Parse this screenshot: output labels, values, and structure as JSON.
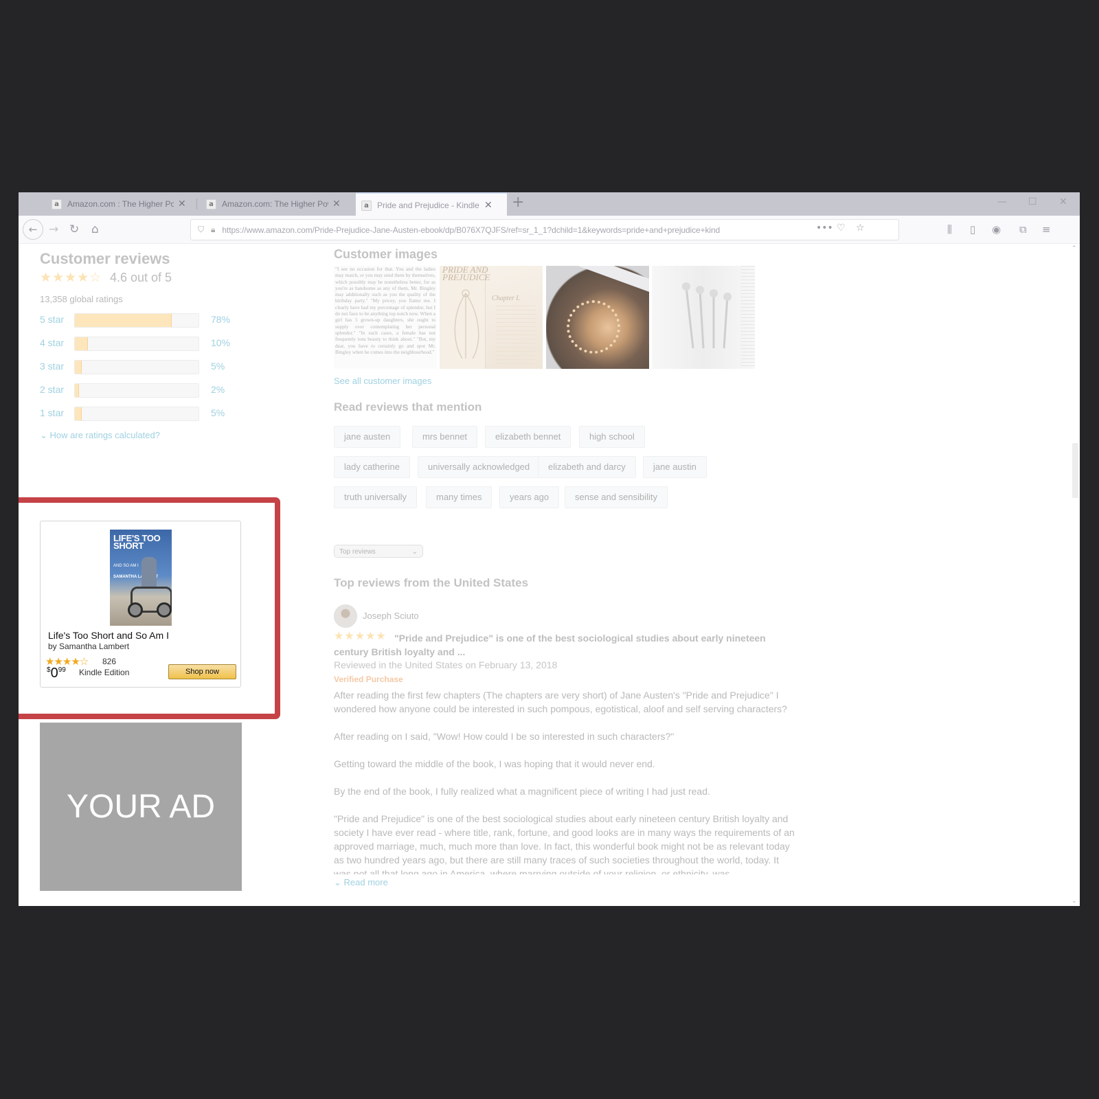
{
  "browser": {
    "tabs": [
      {
        "title": "Amazon.com : The Higher Pow",
        "favicon": "a",
        "close": "✕",
        "active": false
      },
      {
        "title": "Amazon.com: The Higher Pow",
        "favicon": "a",
        "close": "✕",
        "active": false
      },
      {
        "title": "Pride and Prejudice - Kindle ed",
        "favicon": "a",
        "close": "✕",
        "active": true
      }
    ],
    "new_tab": "+",
    "url": "https://www.amazon.com/Pride-Prejudice-Jane-Austen-ebook/dp/B076X7QJFS/ref=sr_1_1?dchild=1&keywords=pride+and+prejudice+kind"
  },
  "reviews_summary": {
    "heading": "Customer reviews",
    "rating_text": "4.6 out of 5",
    "global_ratings": "13,358 global ratings",
    "histogram": [
      {
        "label": "5 star",
        "pct": "78%",
        "value": 78
      },
      {
        "label": "4 star",
        "pct": "10%",
        "value": 10
      },
      {
        "label": "3 star",
        "pct": "5%",
        "value": 5
      },
      {
        "label": "2 star",
        "pct": "2%",
        "value": 2
      },
      {
        "label": "1 star",
        "pct": "5%",
        "value": 5
      }
    ],
    "how_calculated": "How are ratings calculated?"
  },
  "ad": {
    "cover_title": "LIFE'S TOO SHORT",
    "cover_subtitle": "AND SO AM I",
    "cover_author": "SAMANTHA LAMBERT",
    "title": "Life's Too Short and So Am I",
    "author": "by Samantha Lambert",
    "stars": "★★★★☆",
    "rating_count": "826",
    "price_dollar": "$",
    "price_whole": "0",
    "price_cents": "99",
    "edition": "Kindle Edition",
    "shop_label": "Shop now",
    "placeholder": "YOUR AD",
    "highlight_color": "#c54247"
  },
  "customer_images": {
    "heading": "Customer images",
    "see_all": "See all customer images",
    "text_excerpt": "\"I see no occasion for that. You and the ladies may match, or you may send them by themselves, which possibly may be nonetheless better, for as you're as handsome as any of them, Mr. Bingley may additionally such as you the quality of the birthday party.\" \"My pricey, you flatter me. I clearly have had my percentage of splendor, but I do not faux to be anything top notch now. When a girl has 5 grown-up daughters, she ought to supply over contemplating her personal splendor.\" \"In such cases, a female has not frequently tons beauty to think about.\" \"But, my dear, you have to certainly go and spot Mr. Bingley when he comes into the neighbourhood.\"",
    "book_title_art": "PRIDE AND PREJUDICE",
    "chapter_label": "Chapter I."
  },
  "mentions": {
    "heading": "Read reviews that mention",
    "chips": [
      "jane austen",
      "mrs bennet",
      "elizabeth bennet",
      "high school",
      "lady catherine",
      "universally acknowledged",
      "elizabeth and darcy",
      "jane austin",
      "truth universally",
      "many times",
      "years ago",
      "sense and sensibility"
    ]
  },
  "sort": {
    "selected": "Top reviews"
  },
  "top_reviews": {
    "heading": "Top reviews from the United States",
    "review": {
      "author": "Joseph Sciuto",
      "stars": "★★★★★",
      "title": "\"Pride and Prejudice\" is one of the best sociological studies about early nineteen century British loyalty and ...",
      "date": "Reviewed in the United States on February 13, 2018",
      "verified": "Verified Purchase",
      "paragraphs": [
        "After reading the first few chapters (The chapters are very short) of Jane Austen's \"Pride and Prejudice\" I wondered how anyone could be interested in such pompous, egotistical, aloof and self serving characters?",
        "After reading on I said, \"Wow! How could I be so interested in such characters?\"",
        "Getting toward the middle of the book, I was hoping that it would never end.",
        "By the end of the book, I fully realized what a magnificent piece of writing I had just read.",
        "\"Pride and Prejudice\" is one of the best sociological studies about early nineteen century British loyalty and society I have ever read - where title, rank, fortune, and good looks are in many ways the requirements of an approved marriage, much, much more than love. In fact, this wonderful book might not be as relevant today as two hundred years ago, but there are still many traces of such societies throughout the world, today. It was not all that long ago in America, where marrying outside of your religion, or ethnicity, was"
      ],
      "read_more": "Read more"
    }
  }
}
